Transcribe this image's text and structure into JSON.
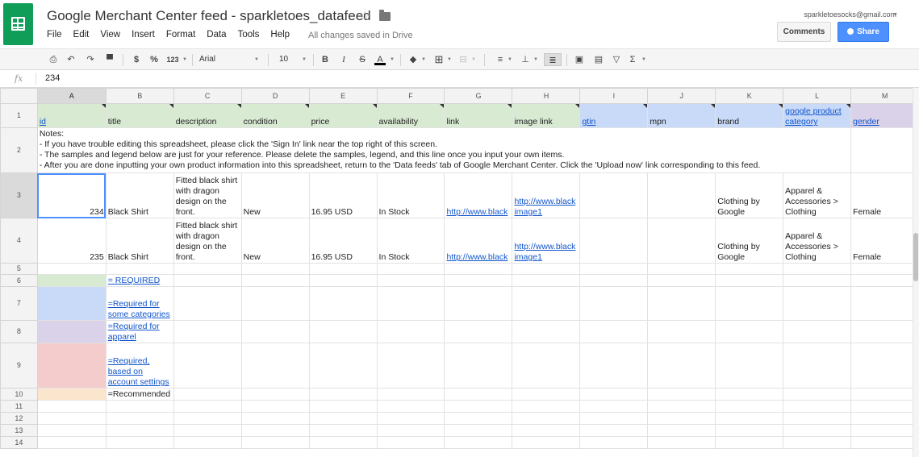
{
  "doc": {
    "title": "Google Merchant Center feed - sparkletoes_datafeed",
    "saved_status": "All changes saved in Drive",
    "account": "sparkletoesocks@gmail.com",
    "comments_label": "Comments",
    "share_label": "Share"
  },
  "menu": [
    "File",
    "Edit",
    "View",
    "Insert",
    "Format",
    "Data",
    "Tools",
    "Help"
  ],
  "toolbar": {
    "currency": "$",
    "percent": "%",
    "number_format": "123",
    "font": "Arial",
    "font_size": "10",
    "bold": "B",
    "italic": "I",
    "strike": "S",
    "text_color": "A",
    "functions": "Σ"
  },
  "formula": {
    "fx": "fx",
    "value": "234"
  },
  "columns": [
    "A",
    "B",
    "C",
    "D",
    "E",
    "F",
    "G",
    "H",
    "I",
    "J",
    "K",
    "L",
    "M"
  ],
  "rows": [
    "1",
    "2",
    "3",
    "4",
    "5",
    "6",
    "7",
    "8",
    "9",
    "10",
    "11",
    "12",
    "13",
    "14"
  ],
  "headers": {
    "id": "id",
    "title": "title",
    "description": "description",
    "condition": "condition",
    "price": "price",
    "availability": "availability",
    "link": "link",
    "image_link": "image link",
    "gtin": "gtin",
    "mpn": "mpn",
    "brand": "brand",
    "google_product_category": "google product category",
    "gender": "gender"
  },
  "notes": [
    "Notes:",
    "- If you have trouble editing this spreadsheet, please click the 'Sign In' link near the top right of this screen.",
    "- The samples and legend below are just for your reference. Please delete the samples, legend, and this line once you input your own items.",
    "- After you are done inputting your own product information into this spreadsheet, return to the 'Data feeds' tab of Google Merchant Center. Click the 'Upload now' link corresponding to this feed."
  ],
  "items": [
    {
      "id": "234",
      "title": "Black Shirt",
      "description": "Fitted black shirt with dragon design on the front.",
      "condition": "New",
      "price": "16.95 USD",
      "availability": "In Stock",
      "link": "http://www.black",
      "image_link": "http://www.black image1",
      "brand": "Clothing by Google",
      "category": "Apparel & Accessories > Clothing",
      "gender": "Female"
    },
    {
      "id": "235",
      "title": "Black Shirt",
      "description": "Fitted black shirt with dragon design on the front.",
      "condition": "New",
      "price": "16.95 USD",
      "availability": "In Stock",
      "link": "http://www.black",
      "image_link": "http://www.black image1",
      "brand": "Clothing by Google",
      "category": "Apparel & Accessories > Clothing",
      "gender": "Female"
    }
  ],
  "legend": {
    "required": "= REQUIRED",
    "required_some": "=Required for some categories",
    "required_apparel": "=Required for apparel",
    "required_account": "=Required, based on account settings",
    "recommended": "=Recommended"
  },
  "colors": {
    "required": "#d9ead3",
    "some_categories": "#c9daf8",
    "apparel": "#d9d2e9",
    "account_settings": "#f4cccc",
    "recommended": "#fce5cd",
    "share_button": "#4d90fe",
    "logo": "#0f9d58"
  }
}
